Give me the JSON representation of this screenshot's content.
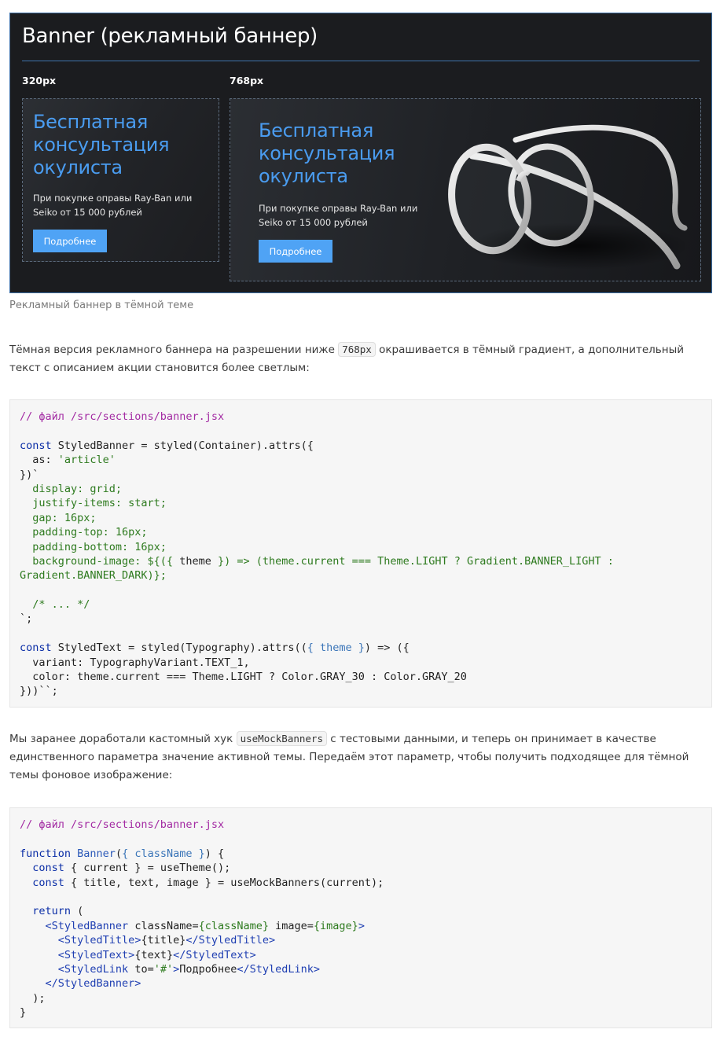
{
  "demo": {
    "title": "Banner (рекламный баннер)",
    "breakpoints": [
      "320px",
      "768px"
    ],
    "banner": {
      "title": "Бесплатная консультация окулиста",
      "text": "При покупке оправы Ray-Ban или Seiko от 15 000 рублей",
      "button": "Подробнее"
    },
    "caption": "Рекламный баннер в тёмной теме"
  },
  "paragraph1": {
    "before": "Тёмная версия рекламного баннера на разрешении ниже ",
    "code": "768px",
    "after": " окрашивается в тёмный градиент, а дополнительный текст с описанием акции становится более светлым:"
  },
  "code1": {
    "lines": [
      [
        {
          "t": "// файл /src/sections/banner.jsx",
          "c": "com"
        }
      ],
      [],
      [
        {
          "t": "const",
          "c": "kw"
        },
        {
          "t": " StyledBanner = styled(Container).attrs({"
        }
      ],
      [
        {
          "t": "  as: "
        },
        {
          "t": "'article'",
          "c": "str"
        }
      ],
      [
        {
          "t": "})`"
        }
      ],
      [
        {
          "t": "  display: grid;",
          "c": "grn"
        }
      ],
      [
        {
          "t": "  justify-items: start;",
          "c": "grn"
        }
      ],
      [
        {
          "t": "  gap: 16px;",
          "c": "grn"
        }
      ],
      [
        {
          "t": "  padding-top: 16px;",
          "c": "grn"
        }
      ],
      [
        {
          "t": "  padding-bottom: 16px;",
          "c": "grn"
        }
      ],
      [
        {
          "t": "  background-image: ${({ ",
          "c": "grn"
        },
        {
          "t": "theme"
        },
        {
          "t": " }) => (",
          "c": "grn"
        },
        {
          "t": "theme.current === Theme.LIGHT ? Gradient.BANNER_LIGHT :",
          "c": "grn"
        }
      ],
      [
        {
          "t": "Gradient.BANNER_DARK)};",
          "c": "grn"
        }
      ],
      [],
      [
        {
          "t": "  /* ... */",
          "c": "grn"
        }
      ],
      [
        {
          "t": "`;"
        }
      ],
      [],
      [
        {
          "t": "const",
          "c": "kw"
        },
        {
          "t": " StyledText = styled(Typography).attrs(("
        },
        {
          "t": "{ theme }",
          "c": "var"
        },
        {
          "t": ") => ({"
        }
      ],
      [
        {
          "t": "  variant: TypographyVariant.TEXT_1,"
        }
      ],
      [
        {
          "t": "  color: theme.current === Theme.LIGHT ? Color.GRAY_30 : Color.GRAY_20"
        }
      ],
      [
        {
          "t": "}))``;"
        }
      ]
    ]
  },
  "paragraph2": {
    "before": "Мы заранее доработали кастомный хук ",
    "code": "useMockBanners",
    "after": " с тестовыми данными, и теперь он принимает в качестве единственного параметра значение активной темы. Передаём этот параметр, чтобы получить подходящее для тёмной темы фоновое изображение:"
  },
  "code2": {
    "lines": [
      [
        {
          "t": "// файл /src/sections/banner.jsx",
          "c": "com"
        }
      ],
      [],
      [
        {
          "t": "function",
          "c": "kw"
        },
        {
          "t": " "
        },
        {
          "t": "Banner",
          "c": "fn"
        },
        {
          "t": "("
        },
        {
          "t": "{ className }",
          "c": "var"
        },
        {
          "t": ") {"
        }
      ],
      [
        {
          "t": "  "
        },
        {
          "t": "const",
          "c": "kw"
        },
        {
          "t": " { current } = useTheme();"
        }
      ],
      [
        {
          "t": "  "
        },
        {
          "t": "const",
          "c": "kw"
        },
        {
          "t": " { title, text, image } = useMockBanners(current);"
        }
      ],
      [],
      [
        {
          "t": "  "
        },
        {
          "t": "return",
          "c": "kw"
        },
        {
          "t": " ("
        }
      ],
      [
        {
          "t": "    "
        },
        {
          "t": "<StyledBanner",
          "c": "tag"
        },
        {
          "t": " className="
        },
        {
          "t": "{className}",
          "c": "grn"
        },
        {
          "t": " image="
        },
        {
          "t": "{image}",
          "c": "grn"
        },
        {
          "t": ">",
          "c": "tag"
        }
      ],
      [
        {
          "t": "      "
        },
        {
          "t": "<StyledTitle>",
          "c": "tag"
        },
        {
          "t": "{title}"
        },
        {
          "t": "</StyledTitle>",
          "c": "tag"
        }
      ],
      [
        {
          "t": "      "
        },
        {
          "t": "<StyledText>",
          "c": "tag"
        },
        {
          "t": "{text}"
        },
        {
          "t": "</StyledText>",
          "c": "tag"
        }
      ],
      [
        {
          "t": "      "
        },
        {
          "t": "<StyledLink",
          "c": "tag"
        },
        {
          "t": " to="
        },
        {
          "t": "'#'",
          "c": "str"
        },
        {
          "t": ">",
          "c": "tag"
        },
        {
          "t": "Подробнее"
        },
        {
          "t": "</StyledLink>",
          "c": "tag"
        }
      ],
      [
        {
          "t": "    "
        },
        {
          "t": "</StyledBanner>",
          "c": "tag"
        }
      ],
      [
        {
          "t": "  );"
        }
      ],
      [
        {
          "t": "}"
        }
      ]
    ]
  },
  "colors": {
    "accent": "#4a9cf0",
    "button": "#4fa3f5",
    "frame_bg": "#1b1c1f",
    "code_bg": "#f6f6f6"
  }
}
